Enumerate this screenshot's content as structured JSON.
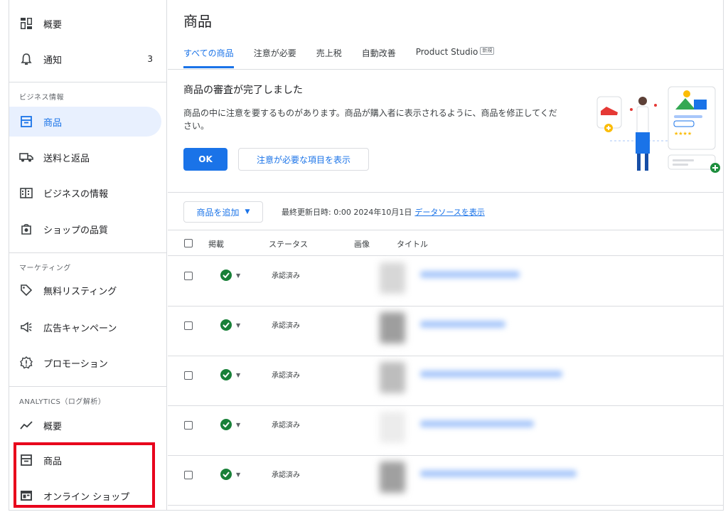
{
  "sidebar": {
    "items": [
      {
        "label": "概要",
        "icon": "dashboard-icon"
      },
      {
        "label": "通知",
        "icon": "bell-icon",
        "count": "3"
      },
      {
        "label": "商品",
        "icon": "product-icon",
        "active": true
      },
      {
        "label": "送料と返品",
        "icon": "truck-icon"
      },
      {
        "label": "ビジネスの情報",
        "icon": "building-icon"
      },
      {
        "label": "ショップの品質",
        "icon": "shop-quality-icon"
      },
      {
        "label": "無料リスティング",
        "icon": "tag-icon"
      },
      {
        "label": "広告キャンペーン",
        "icon": "megaphone-icon"
      },
      {
        "label": "プロモーション",
        "icon": "promotion-icon"
      },
      {
        "label": "概要",
        "icon": "trend-icon"
      },
      {
        "label": "商品",
        "icon": "product-icon"
      },
      {
        "label": "オンライン ショップ",
        "icon": "storefront-icon"
      }
    ],
    "sections": {
      "business": "ビジネス情報",
      "marketing": "マーケティング",
      "analytics": "ANALYTICS（ログ解析）"
    }
  },
  "main": {
    "title": "商品",
    "tabs": [
      {
        "label": "すべての商品",
        "active": true
      },
      {
        "label": "注意が必要"
      },
      {
        "label": "売上税"
      },
      {
        "label": "自動改善"
      },
      {
        "label": "Product Studio",
        "badge": "新規"
      }
    ],
    "banner": {
      "title": "商品の審査が完了しました",
      "text": "商品の中に注意を要するものがあります。商品が購入者に表示されるように、商品を修正してください。",
      "ok_label": "OK",
      "show_label": "注意が必要な項目を表示"
    },
    "toolbar": {
      "add_label": "商品を追加",
      "updated_text": "最終更新日時: 0:00 2024年10月1日",
      "source_link": "データソースを表示"
    },
    "table": {
      "columns": [
        "掲載",
        "ステータス",
        "画像",
        "タイトル"
      ],
      "rows": [
        {
          "status": "承認済み"
        },
        {
          "status": "承認済み"
        },
        {
          "status": "承認済み"
        },
        {
          "status": "承認済み"
        },
        {
          "status": "承認済み"
        }
      ]
    }
  },
  "colors": {
    "accent": "#1a73e8",
    "active_bg": "#e8f0fe",
    "approved": "#188038",
    "highlight": "#e8001c"
  }
}
